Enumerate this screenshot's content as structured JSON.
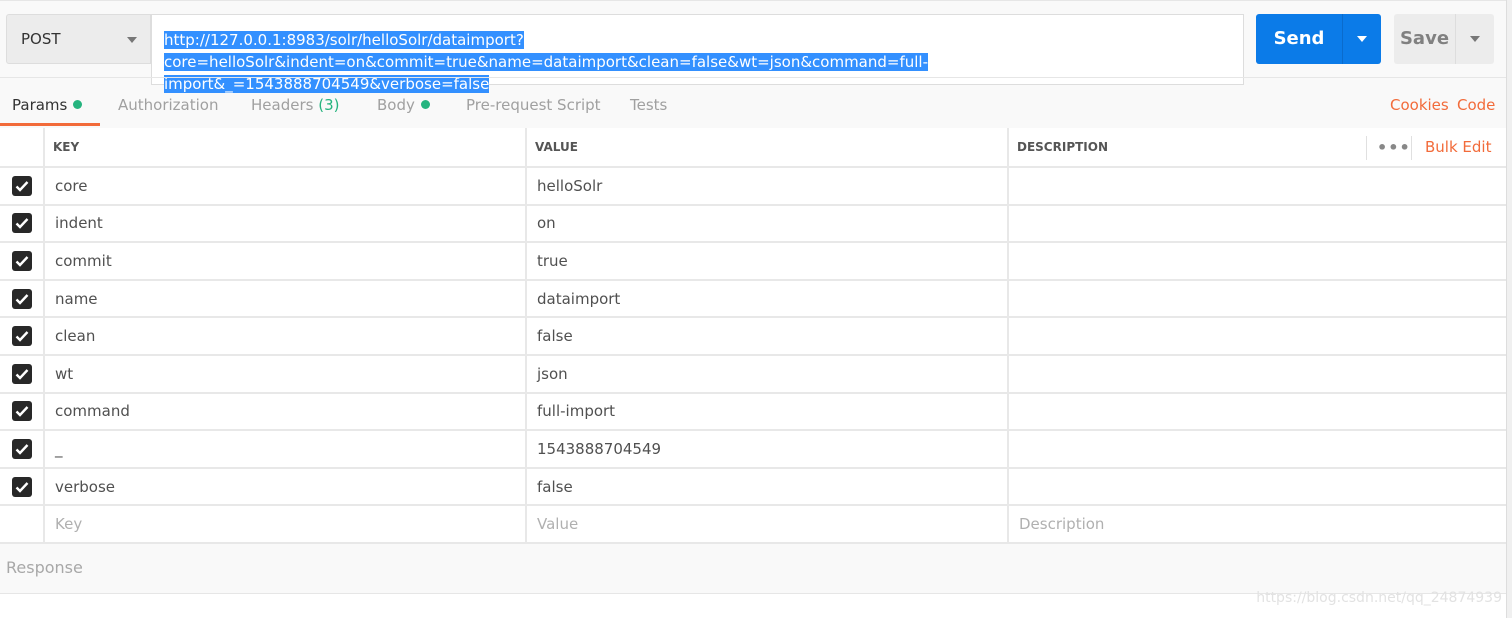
{
  "request": {
    "method": "POST",
    "url": "http://127.0.0.1:8983/solr/helloSolr/dataimport?core=helloSolr&indent=on&commit=true&name=dataimport&clean=false&wt=json&command=full-import&_=1543888704549&verbose=false",
    "url_line1": "http://127.0.0.1:8983/solr/helloSolr/dataimport?core=helloSolr&indent=on&commit=true&name=dataimport&clean=false&wt=json&command=full-",
    "url_line2": "import&_=1543888704549&verbose=false",
    "send_label": "Send",
    "save_label": "Save"
  },
  "tabs": [
    {
      "label": "Params",
      "dot": true,
      "active": true
    },
    {
      "label": "Authorization"
    },
    {
      "label": "Headers",
      "count": "(3)"
    },
    {
      "label": "Body",
      "dot": true
    },
    {
      "label": "Pre-request Script"
    },
    {
      "label": "Tests"
    }
  ],
  "links": {
    "cookies": "Cookies",
    "code": "Code",
    "bulk_edit": "Bulk Edit"
  },
  "table": {
    "headers": [
      "KEY",
      "VALUE",
      "DESCRIPTION"
    ],
    "rows": [
      {
        "key": "core",
        "value": "helloSolr",
        "checked": true
      },
      {
        "key": "indent",
        "value": "on",
        "checked": true
      },
      {
        "key": "commit",
        "value": "true",
        "checked": true
      },
      {
        "key": "name",
        "value": "dataimport",
        "checked": true
      },
      {
        "key": "clean",
        "value": "false",
        "checked": true
      },
      {
        "key": "wt",
        "value": "json",
        "checked": true
      },
      {
        "key": "command",
        "value": "full-import",
        "checked": true
      },
      {
        "key": "_",
        "value": "1543888704549",
        "checked": true
      },
      {
        "key": "verbose",
        "value": "false",
        "checked": true
      }
    ],
    "placeholders": {
      "key": "Key",
      "value": "Value",
      "description": "Description"
    }
  },
  "response": {
    "label": "Response"
  },
  "watermark": "https://blog.csdn.net/qq_24874939",
  "colors": {
    "accent": "#f26b3a",
    "send": "#0b7be8",
    "dot": "#26b47f"
  }
}
